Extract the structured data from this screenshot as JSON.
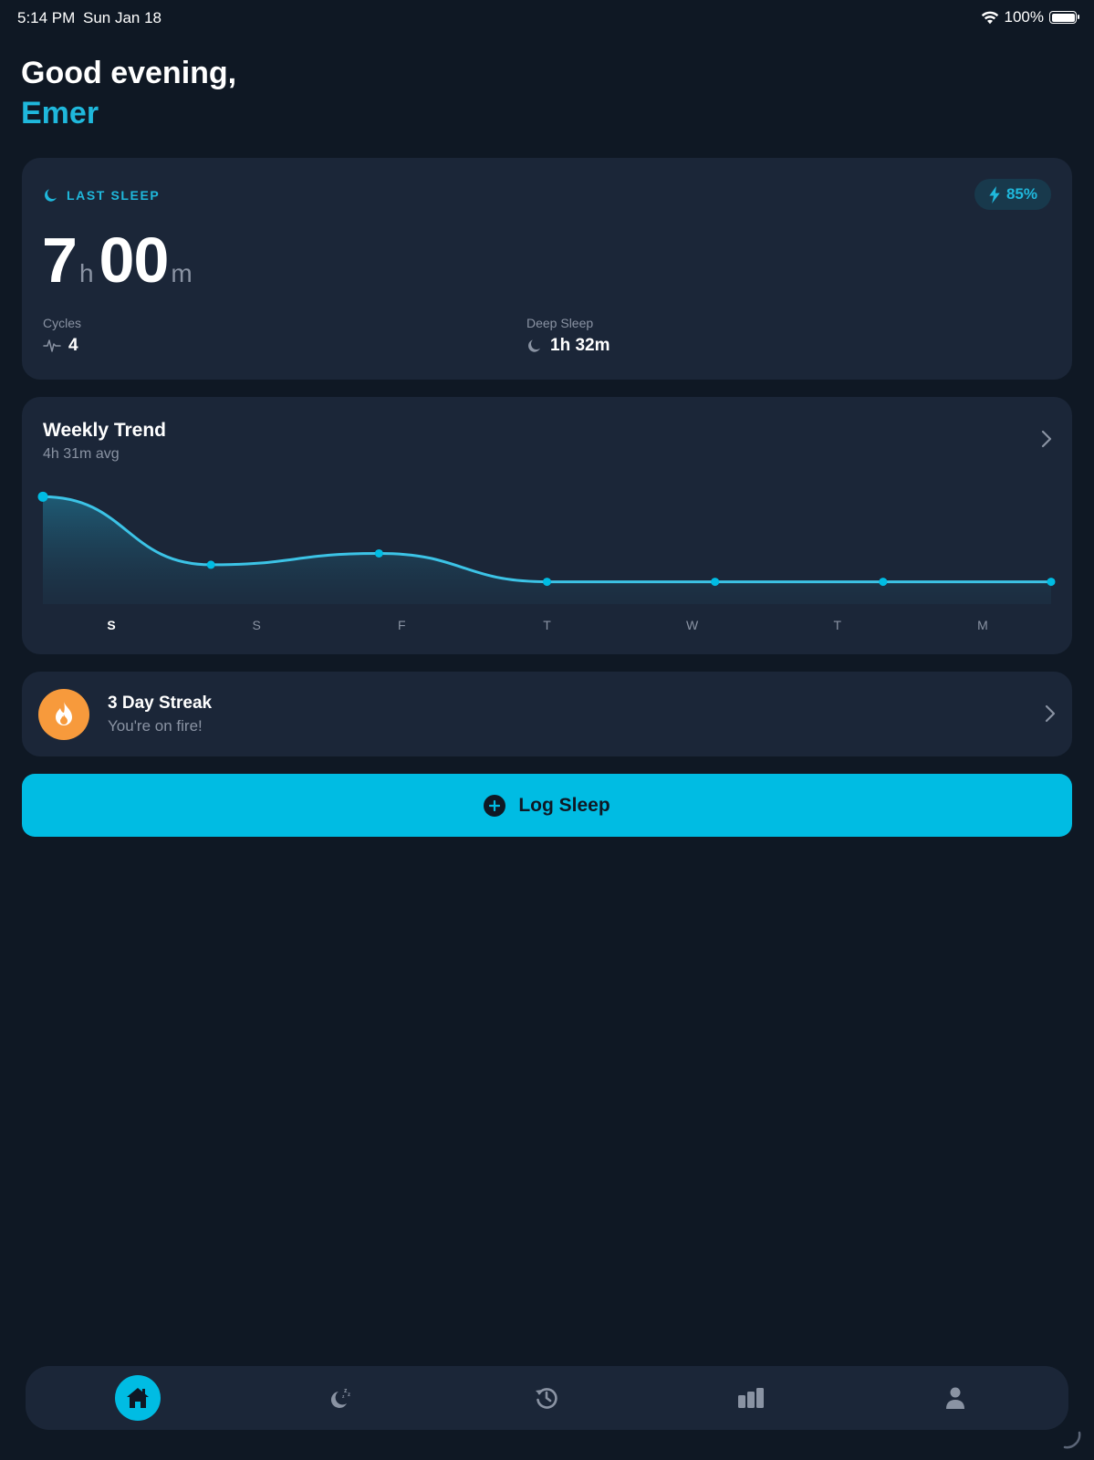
{
  "status_bar": {
    "time": "5:14 PM",
    "date": "Sun Jan 18",
    "battery": "100%"
  },
  "greeting": {
    "line1": "Good evening,",
    "name": "Emer"
  },
  "last_sleep": {
    "label": "LAST SLEEP",
    "battery_pill": "85%",
    "hours": "7",
    "hours_unit": "h",
    "minutes": "00",
    "minutes_unit": "m",
    "cycles_label": "Cycles",
    "cycles_value": "4",
    "deep_label": "Deep Sleep",
    "deep_value": "1h 32m"
  },
  "weekly_trend": {
    "title": "Weekly Trend",
    "subtitle": "4h 31m avg"
  },
  "chart_data": {
    "type": "area",
    "categories": [
      "S",
      "S",
      "F",
      "T",
      "W",
      "T",
      "M"
    ],
    "values": [
      7.0,
      4.6,
      5.0,
      4.0,
      4.0,
      4.0,
      4.0
    ],
    "ylim": [
      3.6,
      7.3
    ],
    "highlight_index": 0,
    "color": "#3cc3e6"
  },
  "streak": {
    "title": "3 Day Streak",
    "subtitle": "You're on fire!"
  },
  "log_button": {
    "label": "Log Sleep"
  },
  "tab_bar": {
    "items": [
      "home-icon",
      "sleep-icon",
      "history-icon",
      "stats-icon",
      "profile-icon"
    ],
    "active": "home-icon"
  },
  "colors": {
    "accent": "#00bce3",
    "background": "#0f1824",
    "card": "#1b2638",
    "streak": "#f79a3c"
  }
}
